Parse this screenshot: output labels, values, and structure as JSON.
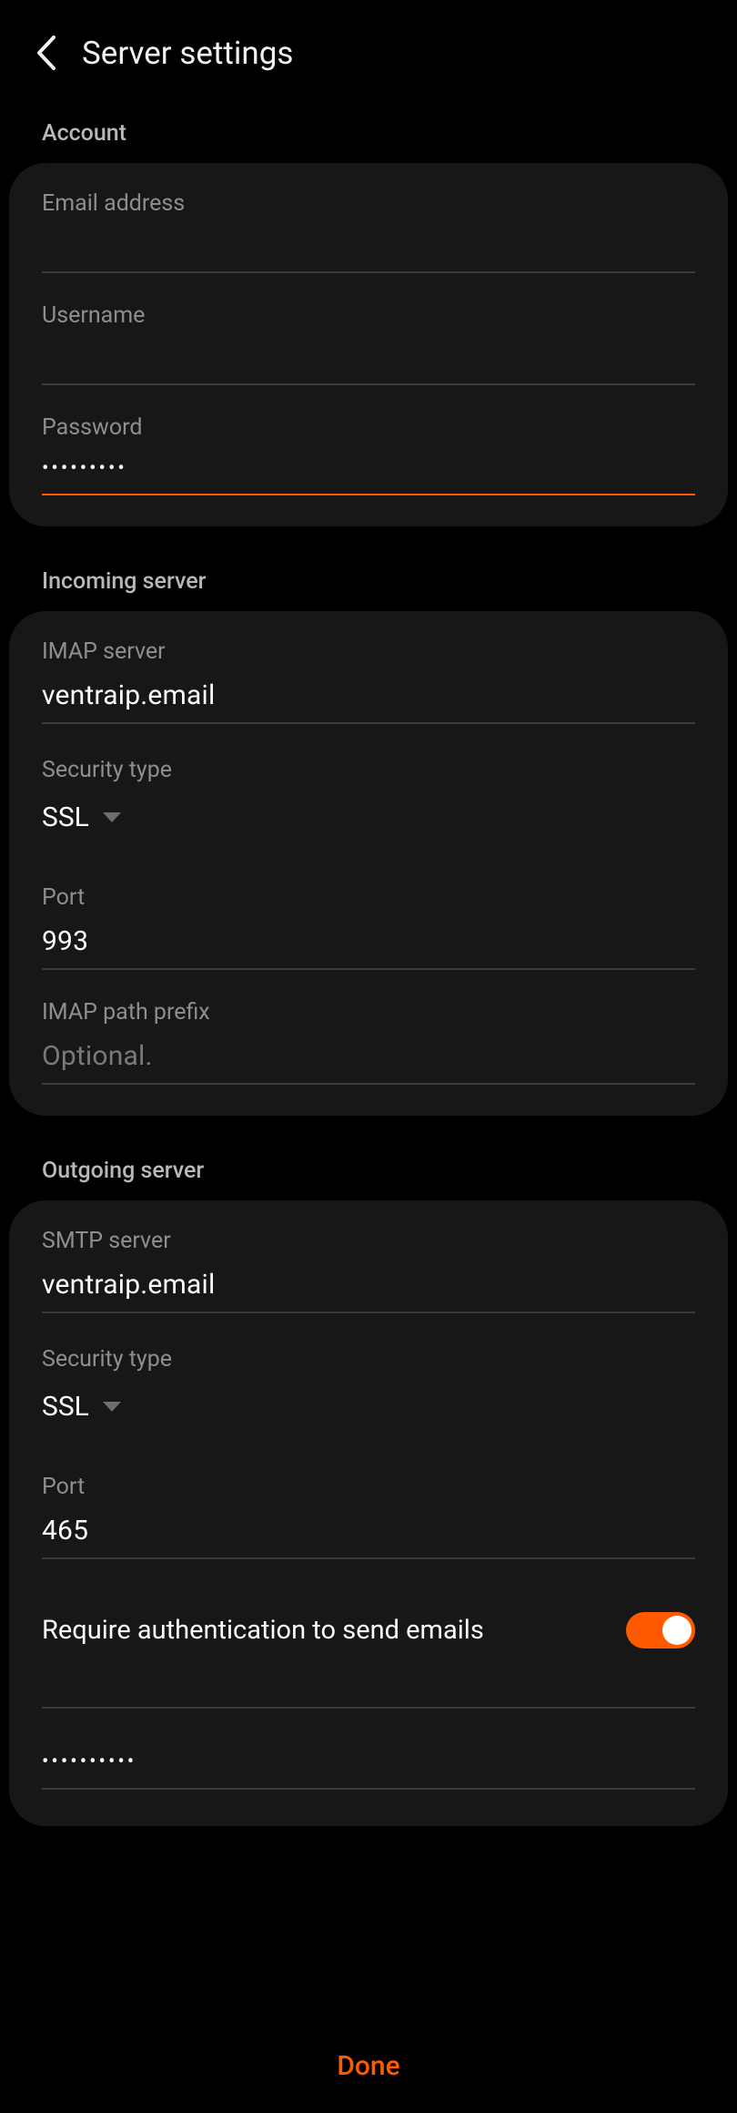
{
  "header": {
    "title": "Server settings"
  },
  "sections": {
    "account": {
      "label": "Account",
      "email_label": "Email address",
      "email_value": "",
      "username_label": "Username",
      "username_value": "",
      "password_label": "Password",
      "password_mask": "•••••••••"
    },
    "incoming": {
      "label": "Incoming server",
      "server_label": "IMAP server",
      "server_value": "ventraip.email",
      "security_label": "Security type",
      "security_value": "SSL",
      "port_label": "Port",
      "port_value": "993",
      "path_prefix_label": "IMAP path prefix",
      "path_prefix_placeholder": "Optional."
    },
    "outgoing": {
      "label": "Outgoing server",
      "server_label": "SMTP server",
      "server_value": "ventraip.email",
      "security_label": "Security type",
      "security_value": "SSL",
      "port_label": "Port",
      "port_value": "465",
      "require_auth_label": "Require authentication to send emails",
      "require_auth_on": true,
      "password_mask": "••••••••••"
    }
  },
  "footer": {
    "done_label": "Done"
  },
  "colors": {
    "accent": "#ff5a00",
    "background": "#000000",
    "card": "#171717",
    "muted_text": "#8e8e8e"
  }
}
